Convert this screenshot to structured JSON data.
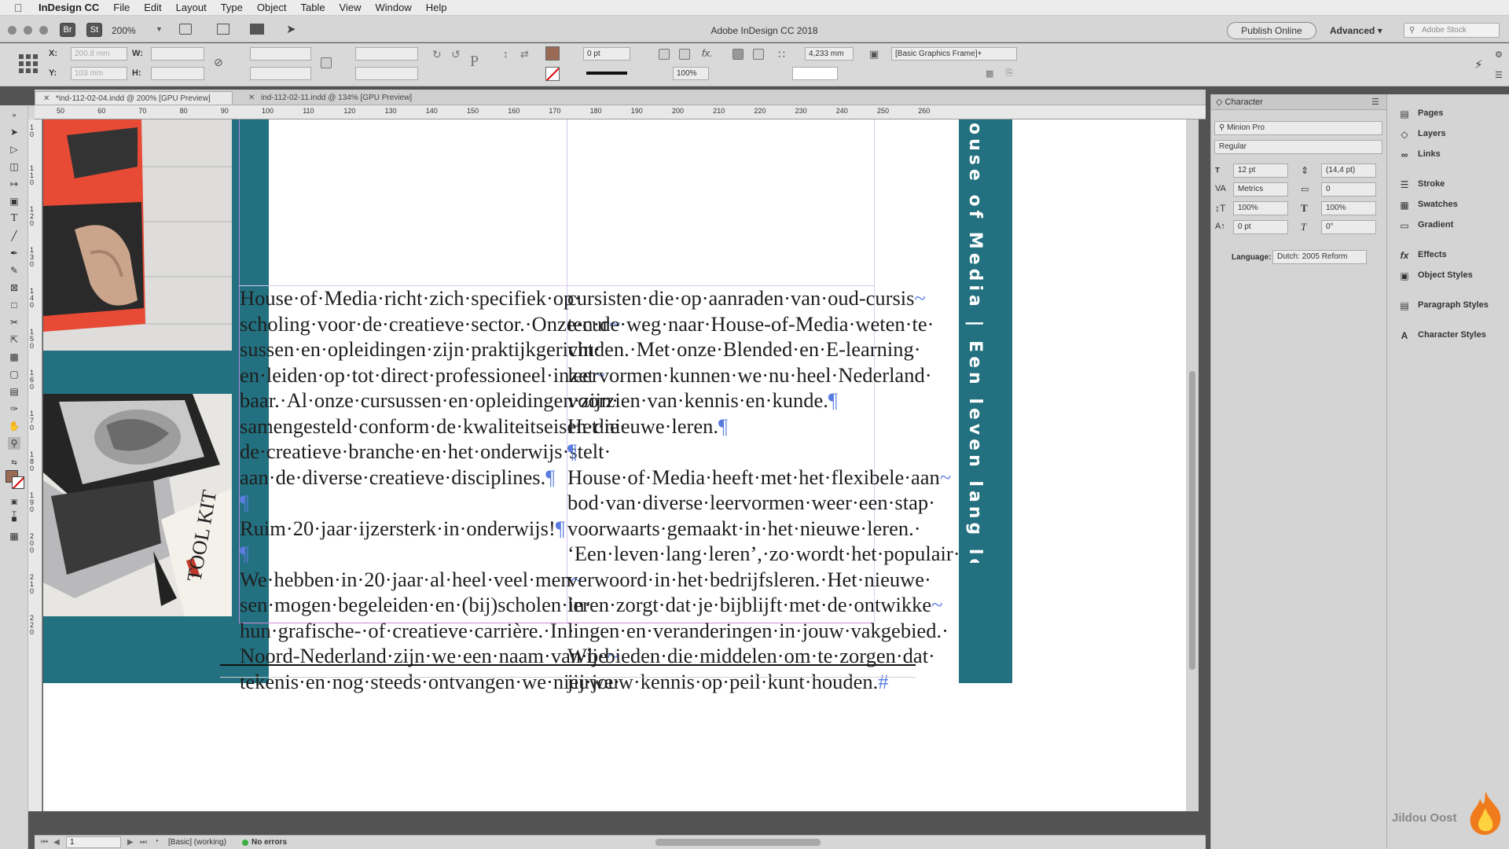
{
  "menubar": {
    "app": "InDesign CC",
    "items": [
      "File",
      "Edit",
      "Layout",
      "Type",
      "Object",
      "Table",
      "View",
      "Window",
      "Help"
    ]
  },
  "appbar": {
    "title": "Adobe InDesign CC 2018",
    "br": "Br",
    "st": "St",
    "zoom": "200%",
    "publish": "Publish Online",
    "workspace": "Advanced",
    "stock_placeholder": "Adobe Stock"
  },
  "control": {
    "x_label": "X:",
    "x_value": "200.8 mm",
    "y_label": "Y:",
    "y_value": "103 mm",
    "w_label": "W:",
    "h_label": "H:",
    "stroke_weight": "0 pt",
    "opacity": "100%",
    "gap": "4,233 mm",
    "object_style": "[Basic Graphics Frame]+"
  },
  "tabs": [
    {
      "label": "*ind-112-02-04.indd @ 200% [GPU Preview]"
    },
    {
      "label": "ind-112-02-11.indd @ 134% [GPU Preview]"
    }
  ],
  "ruler_h": [
    "50",
    "60",
    "70",
    "80",
    "90",
    "100",
    "110",
    "120",
    "130",
    "140",
    "150",
    "160",
    "170",
    "180",
    "190",
    "200",
    "210",
    "220",
    "230",
    "240",
    "250",
    "260"
  ],
  "ruler_v": [
    "1\n0",
    "1\n1\n0",
    "1\n2\n0",
    "1\n3\n0",
    "1\n4\n0",
    "1\n5\n0",
    "1\n6\n0",
    "1\n7\n0",
    "1\n8\n0",
    "1\n9\n0",
    "2\n0\n0",
    "2\n1\n0",
    "2\n2\n0"
  ],
  "document": {
    "col1": [
      "House·of·Media·richt·zich·specifiek·op·",
      "scholing·voor·de·creatieve·sector.·Onze·cur~",
      "sussen·en·opleidingen·zijn·praktijkgericht·",
      "en·leiden·op·tot·direct·professioneel·inzet~",
      "baar.·Al·onze·cursussen·en·opleidingen·zijn·",
      "samengesteld·conform·de·kwaliteitseisen·die·",
      "de·creatieve·branche·en·het·onderwijs·stelt·",
      "aan·de·diverse·creatieve·disciplines.¶",
      "¶",
      "Ruim·20·jaar·ijzersterk·in·onderwijs!¶",
      "¶",
      "We·hebben·in·20·jaar·al·heel·veel·men~",
      "sen·mogen·begeleiden·en·(bij)scholen·in·",
      "hun·grafische-·of·creatieve·carrière.·In·",
      "Noord-Nederland·zijn·we·een·naam·van·be~",
      "tekenis·en·nog·steeds·ontvangen·we·nieuwe·"
    ],
    "col2": [
      "cursisten·die·op·aanraden·van·oud-cursis~",
      "ten·de·weg·naar·House-of-Media·weten·te·",
      "vinden.·Met·onze·Blended·en·E-learning·",
      "leervormen·kunnen·we·nu·heel·Nederland·",
      "voorzien·van·kennis·en·kunde.¶",
      "Het·nieuwe·leren.¶",
      "¶",
      "House·of·Media·heeft·met·het·flexibele·aan~",
      "bod·van·diverse·leervormen·weer·een·stap·",
      "voorwaarts·gemaakt·in·het·nieuwe·leren.·",
      "‘Een·leven·lang·leren’,·zo·wordt·het·populair·",
      "verwoord·in·het·bedrijfsleren.·Het·nieuwe·",
      "leren·zorgt·dat·je·bijblijft·met·de·ontwikke~",
      "lingen·en·veranderingen·in·jouw·vakgebied.·",
      "Wij·bieden·die·middelen·om·te·zorgen·dat·",
      "jij·jouw·kennis·op·peil·kunt·houden.#"
    ],
    "vertical_text": "ouse of Media | Een leven lang leren",
    "teal": "#237180"
  },
  "status": {
    "page": "1",
    "style": "[Basic] (working)",
    "errors": "No errors"
  },
  "character_panel": {
    "title": "Character",
    "font": "Minion Pro",
    "style": "Regular",
    "size": "12 pt",
    "leading": "(14,4 pt)",
    "kerning": "Metrics",
    "tracking": "0",
    "vscale": "100%",
    "hscale": "100%",
    "baseline": "0 pt",
    "skew": "0°",
    "language_label": "Language:",
    "language": "Dutch: 2005 Reform"
  },
  "side_panels": [
    "Pages",
    "Layers",
    "Links",
    "Stroke",
    "Swatches",
    "Gradient",
    "Effects",
    "Object Styles",
    "Paragraph Styles",
    "Character Styles"
  ],
  "watermark": "Jildou Oost"
}
